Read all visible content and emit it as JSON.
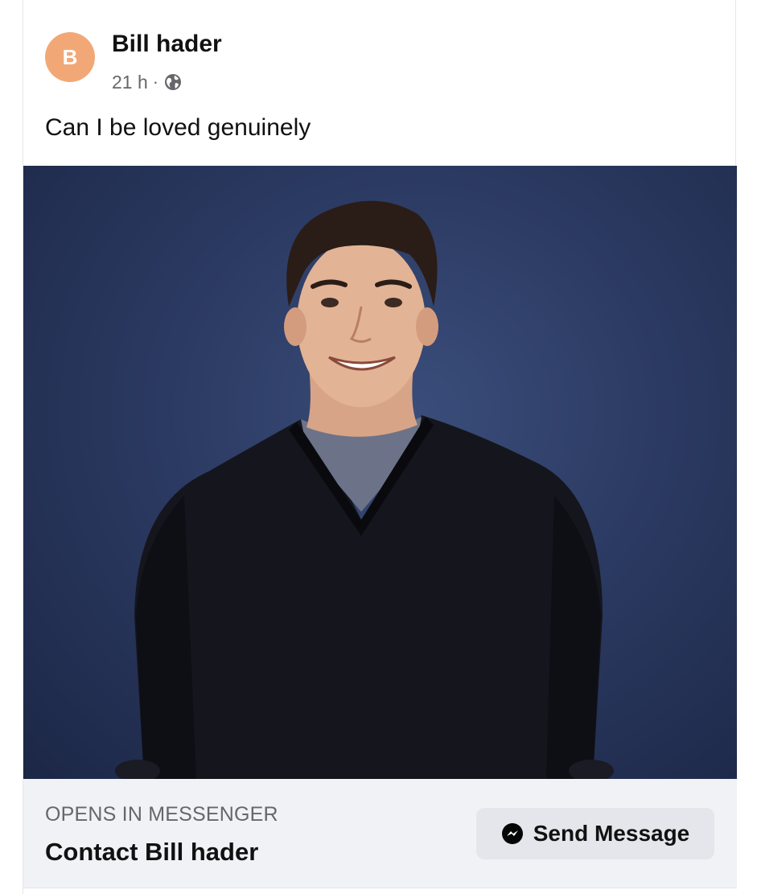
{
  "post": {
    "author": {
      "avatar_letter": "B",
      "avatar_color": "#f2a876",
      "name": "Bill hader"
    },
    "time": "21 h",
    "separator": "·",
    "audience_icon": "globe-icon",
    "text": "Can I be loved genuinely"
  },
  "cta": {
    "caption": "OPENS IN MESSENGER",
    "title": "Contact Bill hader",
    "button_icon": "messenger-icon",
    "button_label": "Send Message"
  }
}
